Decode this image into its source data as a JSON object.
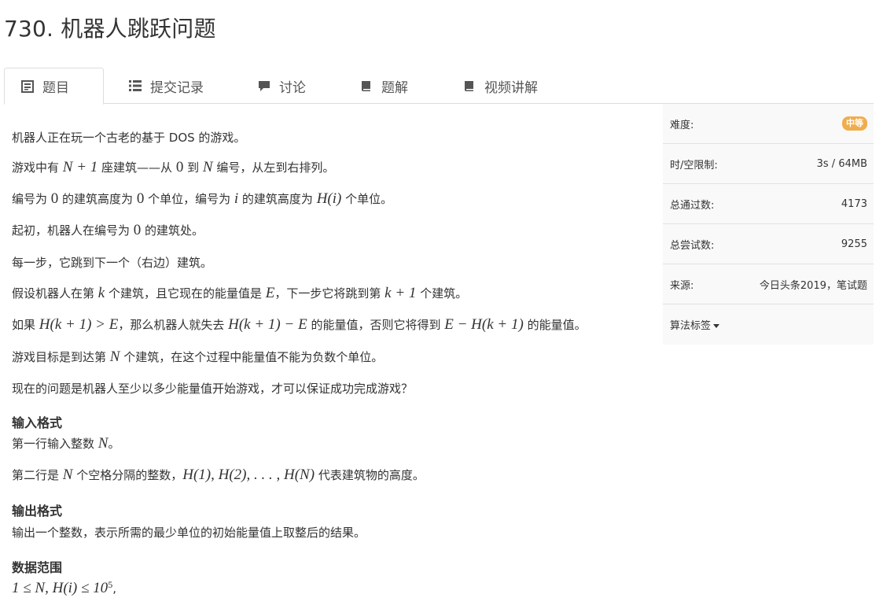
{
  "title": "730. 机器人跳跃问题",
  "tabs": [
    {
      "label": "题目",
      "icon": "list-icon",
      "active": true
    },
    {
      "label": "提交记录",
      "icon": "list-bullets-icon",
      "active": false
    },
    {
      "label": "讨论",
      "icon": "comment-icon",
      "active": false
    },
    {
      "label": "题解",
      "icon": "book-icon",
      "active": false
    },
    {
      "label": "视频讲解",
      "icon": "book-icon",
      "active": false
    }
  ],
  "problem": {
    "line1": "机器人正在玩一个古老的基于 DOS 的游戏。",
    "line2_a": "游戏中有 ",
    "line2_m1": "N + 1",
    "line2_b": " 座建筑——从 ",
    "line2_m2": "0",
    "line2_c": " 到 ",
    "line2_m3": "N",
    "line2_d": " 编号，从左到右排列。",
    "line3_a": "编号为 ",
    "line3_m1": "0",
    "line3_b": " 的建筑高度为 ",
    "line3_m2": "0",
    "line3_c": " 个单位，编号为 ",
    "line3_m3": "i",
    "line3_d": " 的建筑高度为 ",
    "line3_m4": "H(i)",
    "line3_e": " 个单位。",
    "line4_a": "起初，机器人在编号为 ",
    "line4_m1": "0",
    "line4_b": " 的建筑处。",
    "line5": "每一步，它跳到下一个（右边）建筑。",
    "line6_a": "假设机器人在第 ",
    "line6_m1": "k",
    "line6_b": " 个建筑，且它现在的能量值是 ",
    "line6_m2": "E",
    "line6_c": "，下一步它将跳到第 ",
    "line6_m3": "k + 1",
    "line6_d": " 个建筑。",
    "line7_a": "如果 ",
    "line7_m1": "H(k + 1) > E",
    "line7_b": "，那么机器人就失去 ",
    "line7_m2": "H(k + 1) − E",
    "line7_c": " 的能量值，否则它将得到 ",
    "line7_m3": "E − H(k + 1)",
    "line7_d": " 的能量值。",
    "line8_a": "游戏目标是到达第 ",
    "line8_m1": "N",
    "line8_b": " 个建筑，在这个过程中能量值不能为负数个单位。",
    "line9": "现在的问题是机器人至少以多少能量值开始游戏，才可以保证成功完成游戏？",
    "input_heading": "输入格式",
    "input1_a": "第一行输入整数 ",
    "input1_m1": "N",
    "input1_b": "。",
    "input2_a": "第二行是 ",
    "input2_m1": "N",
    "input2_b": " 个空格分隔的整数，",
    "input2_m2": "H(1), H(2), . . . , H(N)",
    "input2_c": " 代表建筑物的高度。",
    "output_heading": "输出格式",
    "output1": "输出一个整数，表示所需的最少单位的初始能量值上取整后的结果。",
    "range_heading": "数据范围",
    "range_m1": "1 ≤ N, H(i) ≤ 10",
    "range_exp": "5",
    "range_tail": ","
  },
  "side": {
    "difficulty_label": "难度:",
    "difficulty_value": "中等",
    "limit_label": "时/空限制:",
    "limit_value": "3s / 64MB",
    "pass_label": "总通过数:",
    "pass_value": "4173",
    "try_label": "总尝试数:",
    "try_value": "9255",
    "source_label": "来源:",
    "source_value": "今日头条2019，笔试题",
    "tags_label": "算法标签"
  },
  "colors": {
    "badge": "#f0ad4e",
    "side_bg": "#f9f9f9",
    "border": "#dddddd"
  }
}
